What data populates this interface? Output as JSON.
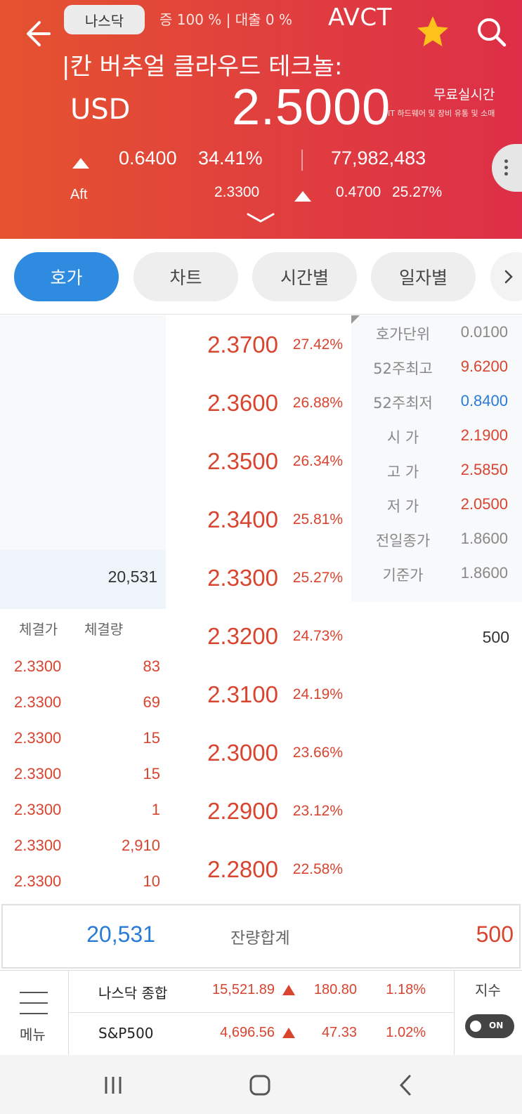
{
  "header": {
    "exchange": "나스닥",
    "margin_info": "증 100 % | 대출 0 %",
    "ticker": "AVCT",
    "stock_name": "|칸 버추얼 클라우드 테크놀:",
    "currency": "USD",
    "price": "2.5000",
    "realtime_label": "무료실시간",
    "sector": "IT 하드웨어 및 장비 유통 및 소매",
    "change": "0.6400",
    "change_pct": "34.41%",
    "volume": "77,982,483",
    "after_label": "Aft",
    "after_price": "2.3300",
    "after_change": "0.4700",
    "after_change_pct": "25.27%"
  },
  "tabs": [
    {
      "label": "호가",
      "active": true
    },
    {
      "label": "차트",
      "active": false
    },
    {
      "label": "시간별",
      "active": false
    },
    {
      "label": "일자별",
      "active": false
    }
  ],
  "order_book": {
    "asks": [
      {
        "price": "2.3700",
        "pct": "27.42%"
      },
      {
        "price": "2.3600",
        "pct": "26.88%"
      },
      {
        "price": "2.3500",
        "pct": "26.34%"
      },
      {
        "price": "2.3400",
        "pct": "25.81%"
      },
      {
        "price": "2.3300",
        "pct": "25.27%"
      },
      {
        "price": "2.3200",
        "pct": "24.73%"
      },
      {
        "price": "2.3100",
        "pct": "24.19%"
      },
      {
        "price": "2.3000",
        "pct": "23.66%"
      },
      {
        "price": "2.2900",
        "pct": "23.12%"
      },
      {
        "price": "2.2800",
        "pct": "22.58%"
      }
    ],
    "bid_qty": "20,531",
    "ask_qty": "500",
    "info": [
      {
        "label": "호가단위",
        "value": "0.0100",
        "color": "#888888"
      },
      {
        "label": "52주최고",
        "value": "9.6200",
        "color": "#d9442f"
      },
      {
        "label": "52주최저",
        "value": "0.8400",
        "color": "#2a7bd6"
      },
      {
        "label": "시   가",
        "value": "2.1900",
        "color": "#d9442f"
      },
      {
        "label": "고   가",
        "value": "2.5850",
        "color": "#d9442f"
      },
      {
        "label": "저   가",
        "value": "2.0500",
        "color": "#d9442f"
      },
      {
        "label": "전일종가",
        "value": "1.8600",
        "color": "#888888"
      },
      {
        "label": "기준가",
        "value": "1.8600",
        "color": "#888888"
      }
    ],
    "trades_header": {
      "price": "체결가",
      "volume": "체결량"
    },
    "trades": [
      {
        "price": "2.3300",
        "volume": "83"
      },
      {
        "price": "2.3300",
        "volume": "69"
      },
      {
        "price": "2.3300",
        "volume": "15"
      },
      {
        "price": "2.3300",
        "volume": "15"
      },
      {
        "price": "2.3300",
        "volume": "1"
      },
      {
        "price": "2.3300",
        "volume": "2,910"
      },
      {
        "price": "2.3300",
        "volume": "10"
      }
    ]
  },
  "totals": {
    "bid": "20,531",
    "label": "잔량합계",
    "ask": "500"
  },
  "indices": {
    "menu_label": "메뉴",
    "toggle_label": "지수",
    "toggle_state": "ON",
    "rows": [
      {
        "name": "나스닥 종합",
        "value": "15,521.89",
        "change": "180.80",
        "pct": "1.18%"
      },
      {
        "name": "S&P500",
        "value": "4,696.56",
        "change": "47.33",
        "pct": "1.02%"
      }
    ]
  },
  "colors": {
    "up": "#d9442f",
    "down": "#2a7bd6",
    "accent": "#2f8be0",
    "header_start": "#e5532f",
    "header_end": "#dd2f47"
  }
}
